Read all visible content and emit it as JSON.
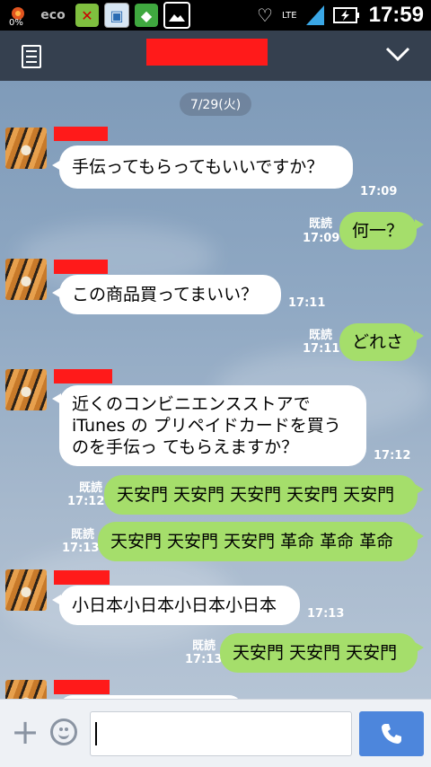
{
  "status_bar": {
    "time": "17:59",
    "network": "LTE",
    "battery_small_label": "0%"
  },
  "header": {
    "menu_icon": "memo-icon",
    "chevron_icon": "chevron-down-icon"
  },
  "chat": {
    "date_label": "7/29(火)",
    "read_label": "既読",
    "messages": [
      {
        "dir": "in",
        "text": "手伝ってもらってもいいですか？",
        "time": "17:09"
      },
      {
        "dir": "out",
        "text": "何一？",
        "time": "17:09"
      },
      {
        "dir": "in",
        "text": "この商品買ってまいい？",
        "time": "17:11"
      },
      {
        "dir": "out",
        "text": "どれさ",
        "time": "17:11"
      },
      {
        "dir": "in",
        "lines": [
          "近くのコンビニエンスストアで",
          "iTunes の プリペイドカードを買う",
          "のを手伝っ てもらえますか？"
        ],
        "time": "17:12"
      },
      {
        "dir": "out",
        "text": "天安門 天安門 天安門 天安門 天安門",
        "time": "17:12"
      },
      {
        "dir": "out",
        "text": "天安門 天安門 天安門 革命 革命 革命",
        "time": "17:13"
      },
      {
        "dir": "in",
        "text": "小日本小日本小日本小日本",
        "time": "17:13"
      },
      {
        "dir": "out",
        "text": "天安門 天安門 天安門",
        "time": "17:13"
      }
    ]
  },
  "input_bar": {
    "plus_icon": "plus-icon",
    "emoji_icon": "smiley-icon",
    "call_icon": "phone-icon"
  }
}
